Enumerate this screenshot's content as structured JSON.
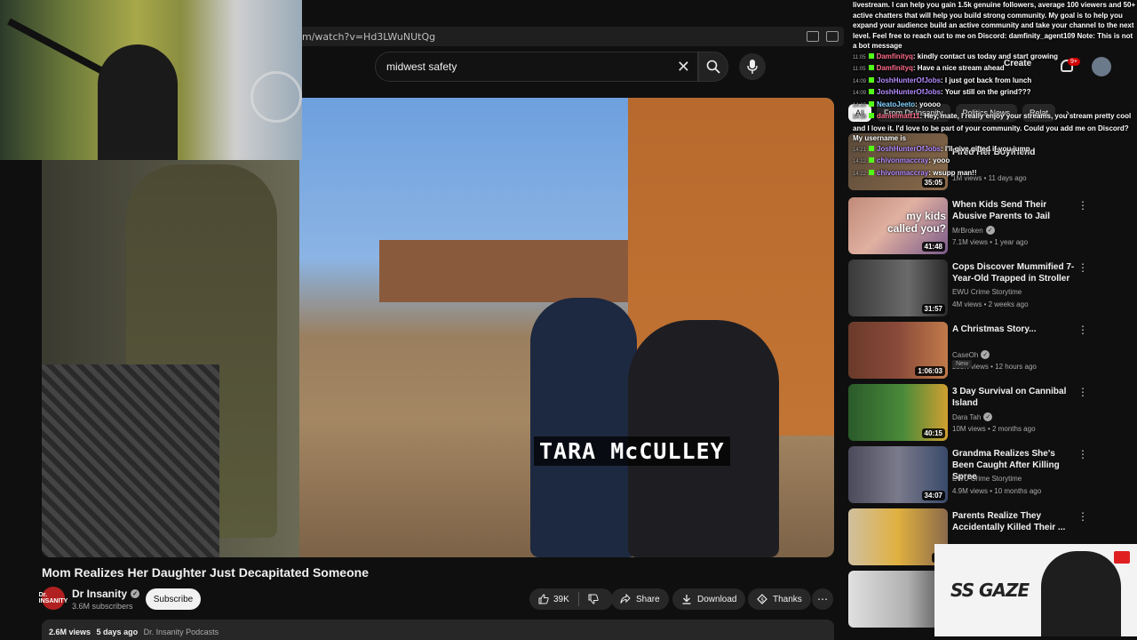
{
  "browser": {
    "url": "m/watch?v=Hd3LWuNUtQg"
  },
  "search": {
    "query": "midwest safety"
  },
  "video": {
    "caption": "TARA McCULLEY",
    "title": "Mom Realizes Her Daughter Just Decapitated Someone",
    "channel": "Dr Insanity",
    "avatar_text": "Dr. INSANITY",
    "subscribers": "3.6M subscribers",
    "subscribe_label": "Subscribe",
    "likes": "39K",
    "share_label": "Share",
    "download_label": "Download",
    "thanks_label": "Thanks",
    "views": "2.6M views",
    "age": "5 days ago",
    "tag": "Dr. Insanity Podcasts"
  },
  "header": {
    "create_label": "Create",
    "notif_count": "9+"
  },
  "chips": [
    "All",
    "From Dr Insanity",
    "Politics News",
    "Relat"
  ],
  "recommendations": [
    {
      "title": "When Kids Send Their Abusive Parents to Jail",
      "channel": "MrBroken",
      "views": "7.1M views",
      "age": "1 year ago",
      "duration": "41:48",
      "thumb_text": "my kids called you?",
      "badge": ""
    },
    {
      "title": "Cops Discover Mummified 7-Year-Old Trapped in Stroller",
      "channel": "EWU Crime Storytime",
      "views": "4M views",
      "age": "2 weeks ago",
      "duration": "31:57",
      "badge": ""
    },
    {
      "title": "A Christmas Story...",
      "channel": "CaseOh",
      "views": "258K views",
      "age": "12 hours ago",
      "duration": "1:06:03",
      "badge": "New"
    },
    {
      "title": "3 Day Survival on Cannibal Island",
      "channel": "Dara Tah",
      "views": "10M views",
      "age": "2 months ago",
      "duration": "40:15",
      "badge": ""
    },
    {
      "title": "Grandma Realizes She's Been Caught After Killing Spree",
      "channel": "EWU Crime Storytime",
      "views": "4.9M views",
      "age": "10 months ago",
      "duration": "34:07",
      "badge": ""
    },
    {
      "title": "Parents Realize They Accidentally Killed Their ...",
      "channel": "",
      "views": "",
      "age": "",
      "duration": "38",
      "badge": ""
    }
  ],
  "partial_top": {
    "title": "Fired Her Boyfriend",
    "views": "1M views • 11 days ago",
    "duration": "35:05"
  },
  "chat": [
    {
      "ts": "",
      "user": "",
      "text": "livestream. I can help you gain 1.5k genuine followers, average 100 viewers and 50+ active chatters that will help you build strong community. My goal is to help you expand your audience build an active community and take your channel to the next level. Feel free to reach out to me on Discord: damfinity_agent109 Note: This is not a bot message"
    },
    {
      "ts": "11:05",
      "user": "Damfinityq",
      "text": ": kindly contact us today and start growing"
    },
    {
      "ts": "11:05",
      "user": "Damfinityq",
      "text": ": Have a nice stream ahead"
    },
    {
      "ts": "14:09",
      "user": "JoshHunterOfJobs",
      "text": ": I just got back from lunch"
    },
    {
      "ts": "14:09",
      "user": "JoshHunterOfJobs",
      "text": ": Your still on the grind???"
    },
    {
      "ts": "14:10",
      "user": "NeatoJeeto",
      "text": ": yoooo"
    },
    {
      "ts": "14:18",
      "user": "danielmatt11",
      "text": ": Hey, mate, I really enjoy your streams, you stream pretty cool and I love it. I'd love to be part of your community. Could you add me on Discord? My username is"
    },
    {
      "ts": "14:21",
      "user": "JoshHunterOfJobs",
      "text": ": I'll give gifted if you jump"
    },
    {
      "ts": "14:22",
      "user": "chivonmaccray",
      "text": ": yooo"
    },
    {
      "ts": "14:22",
      "user": "chivonmaccray",
      "text": ": wsupp man!!"
    }
  ],
  "sponsor": {
    "logo": "SS GAZE"
  },
  "colors": {
    "background": "#0f0f0f",
    "chip_bg": "#272727",
    "accent_red": "#cc0000",
    "kick_green": "#53fc18"
  },
  "icons": [
    "search-icon",
    "mic-icon",
    "close-icon",
    "like-icon",
    "dislike-icon",
    "share-icon",
    "download-icon",
    "thanks-icon",
    "more-icon",
    "bell-icon",
    "chevron-right-icon",
    "verified-icon"
  ]
}
